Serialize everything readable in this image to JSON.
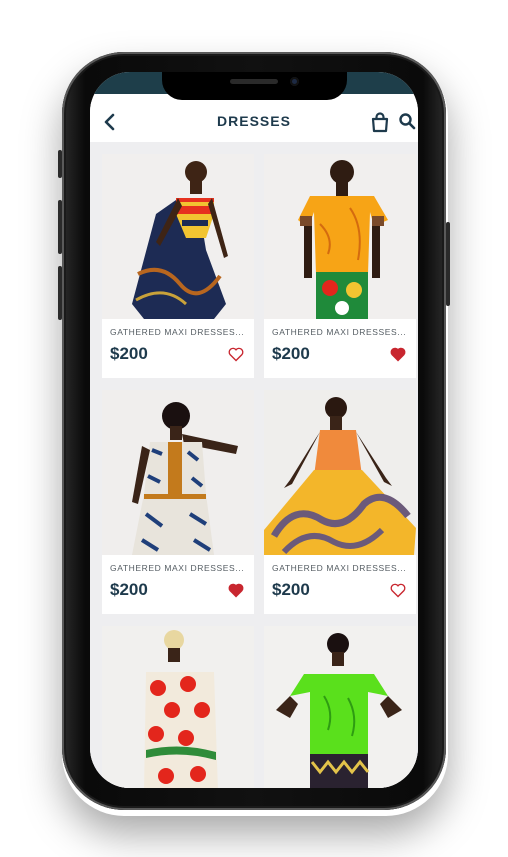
{
  "header": {
    "title": "DRESSES",
    "back_icon": "chevron-left-icon",
    "bag_icon": "shopping-bag-icon",
    "search_icon": "search-icon"
  },
  "colors": {
    "brand": "#1e3a4c",
    "favorite": "#c8262f",
    "background": "#eeeef0"
  },
  "products": [
    {
      "name": "GATHERED MAXI DRESSES...",
      "price": "$200",
      "favorited": false
    },
    {
      "name": "GATHERED MAXI DRESSES...",
      "price": "$200",
      "favorited": true
    },
    {
      "name": "GATHERED MAXI DRESSES...",
      "price": "$200",
      "favorited": true
    },
    {
      "name": "GATHERED MAXI DRESSES...",
      "price": "$200",
      "favorited": false
    },
    {
      "name": "",
      "price": "",
      "favorited": false
    },
    {
      "name": "",
      "price": "",
      "favorited": false
    }
  ]
}
